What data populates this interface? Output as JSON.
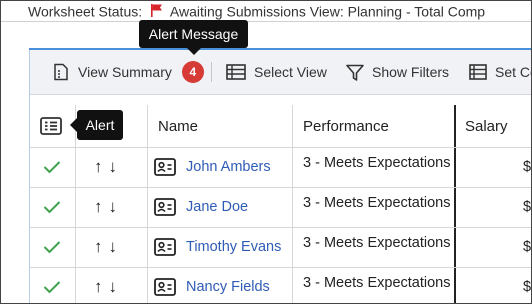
{
  "header": {
    "status_label": "Worksheet Status:",
    "status_value": "Awaiting Submissions",
    "view_label": "View: Planning - Total Comp"
  },
  "toolbar": {
    "view_summary": "View Summary",
    "alert_count": "4",
    "select_view": "Select View",
    "show_filters": "Show Filters",
    "set_columns": "Set Co"
  },
  "tooltips": {
    "alert_message": "Alert Message",
    "alert": "Alert"
  },
  "table": {
    "columns": [
      "Name",
      "Performance",
      "Salary"
    ],
    "rows": [
      {
        "name": "John Ambers",
        "performance": "3 - Meets Expectations",
        "salary": "$"
      },
      {
        "name": "Jane Doe",
        "performance": "3 - Meets Expectations",
        "salary": "$"
      },
      {
        "name": "Timothy Evans",
        "performance": "3 - Meets Expectations",
        "salary": "$"
      },
      {
        "name": "Nancy Fields",
        "performance": "3 - Meets Expectations",
        "salary": "$"
      }
    ]
  },
  "colors": {
    "flag": "#d6262b",
    "badge": "#d63b35",
    "check": "#3fa34d",
    "link": "#2f5db5",
    "accent": "#4a90d9"
  },
  "icons": {
    "status": "flag-icon",
    "view_summary": "summary-icon",
    "select_view": "table-icon",
    "show_filters": "filter-icon",
    "set_columns": "columns-icon",
    "alert_column": "alert-list-icon",
    "row_ok": "check-icon",
    "row_move": "up-down-arrows-icon",
    "employee": "contact-card-icon"
  }
}
